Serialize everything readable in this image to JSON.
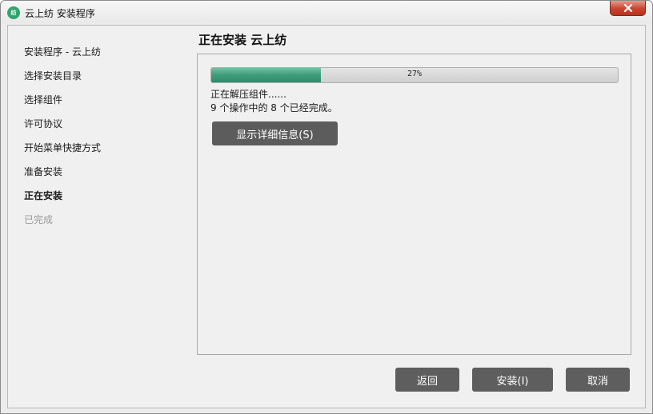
{
  "window": {
    "title": "云上纺 安装程序",
    "icon_text": "纺",
    "icon_color": "#2fa56d",
    "close_icon": "close-x"
  },
  "sidebar": {
    "items": [
      {
        "label": "安装程序 - 云上纺",
        "state": "done"
      },
      {
        "label": "选择安装目录",
        "state": "done"
      },
      {
        "label": "选择组件",
        "state": "done"
      },
      {
        "label": "许可协议",
        "state": "done"
      },
      {
        "label": "开始菜单快捷方式",
        "state": "done"
      },
      {
        "label": "准备安装",
        "state": "done"
      },
      {
        "label": "正在安装",
        "state": "current"
      },
      {
        "label": "已完成",
        "state": "pending"
      }
    ]
  },
  "main": {
    "heading": "正在安装 云上纺",
    "progress": {
      "value": 27,
      "label": "27%",
      "fill_color": "#3f9c7b"
    },
    "status_line1": "正在解压组件......",
    "status_line2": "9 个操作中的 8 个已经完成。",
    "details_button": "显示详细信息(S)"
  },
  "footer": {
    "back_label": "返回",
    "install_label": "安装(I)",
    "cancel_label": "取消"
  }
}
